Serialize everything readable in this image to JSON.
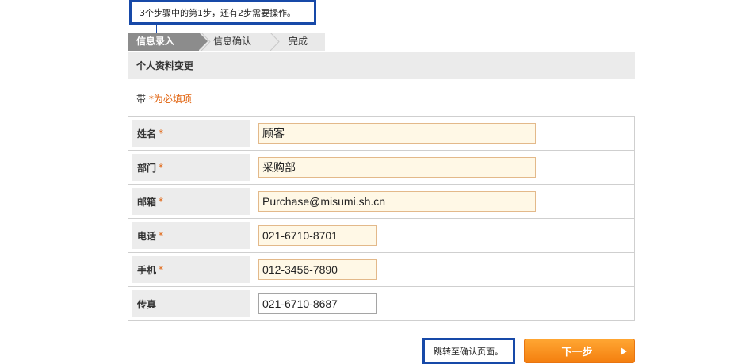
{
  "callouts": {
    "top": "3个步骤中的第1步，还有2步需要操作。",
    "bottom": "跳转至确认页面。"
  },
  "steps": [
    {
      "label": "信息录入",
      "active": true
    },
    {
      "label": "信息确认",
      "active": false
    },
    {
      "label": "完成",
      "active": false
    }
  ],
  "section_title": "个人资料变更",
  "required_note": {
    "prefix": "带 ",
    "text": "*为必填项"
  },
  "form": {
    "rows": [
      {
        "label": "姓名",
        "required_mark": "*",
        "value": "顾客"
      },
      {
        "label": "部门",
        "required_mark": "*",
        "value": "采购部"
      },
      {
        "label": "邮箱",
        "required_mark": "*",
        "value": "Purchase@misumi.sh.cn"
      },
      {
        "label": "电话",
        "required_mark": "*",
        "value": "021-6710-8701"
      },
      {
        "label": "手机",
        "required_mark": "*",
        "value": "012-3456-7890"
      },
      {
        "label": "传真",
        "required_mark": "",
        "value": "021-6710-8687"
      }
    ]
  },
  "next_button": {
    "label": "下一步",
    "icon": "play-arrow-icon"
  },
  "colors": {
    "accent": "#f4890f",
    "callout_border": "#1749a8",
    "required": "#e0620d",
    "field_bg": "#fff8e6"
  }
}
